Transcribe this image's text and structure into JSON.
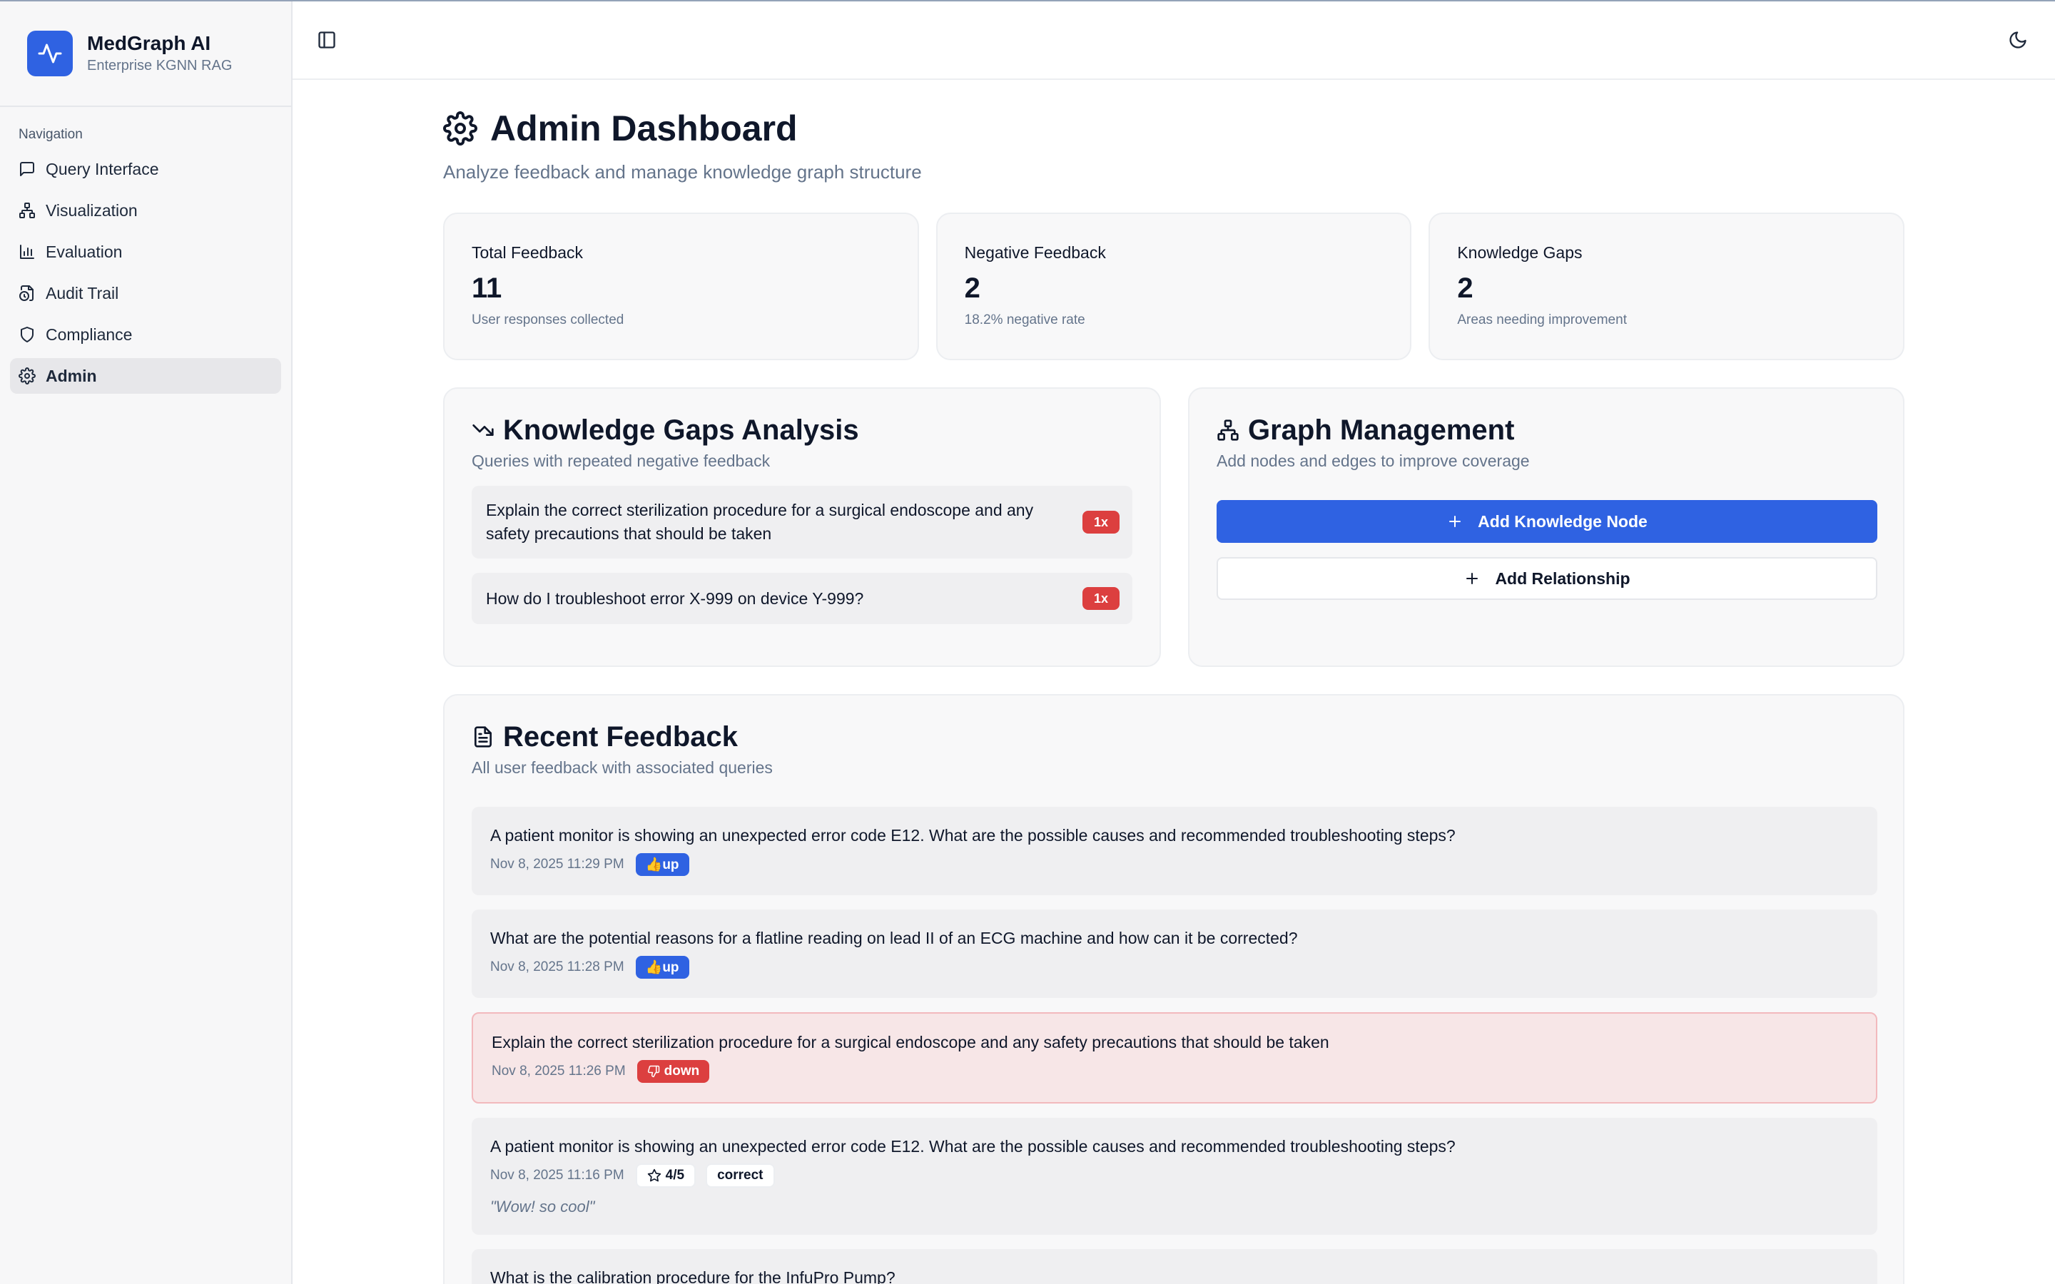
{
  "brand": {
    "title": "MedGraph AI",
    "subtitle": "Enterprise KGNN RAG",
    "accent": "#2f62e2"
  },
  "sidebar": {
    "section_label": "Navigation",
    "items": [
      {
        "label": "Query Interface",
        "icon": "message-square-icon"
      },
      {
        "label": "Visualization",
        "icon": "network-icon"
      },
      {
        "label": "Evaluation",
        "icon": "bar-chart-icon"
      },
      {
        "label": "Audit Trail",
        "icon": "file-clock-icon"
      },
      {
        "label": "Compliance",
        "icon": "shield-icon"
      },
      {
        "label": "Admin",
        "icon": "gear-icon",
        "active": true
      }
    ]
  },
  "topbar": {
    "sidebar_toggle_icon": "panel-left-icon",
    "theme_icon": "moon-icon"
  },
  "page": {
    "title": "Admin Dashboard",
    "subtitle": "Analyze feedback and manage knowledge graph structure",
    "icon": "gear-icon"
  },
  "stats": [
    {
      "label": "Total Feedback",
      "value": "11",
      "desc": "User responses collected"
    },
    {
      "label": "Negative Feedback",
      "value": "2",
      "desc": "18.2% negative rate"
    },
    {
      "label": "Knowledge Gaps",
      "value": "2",
      "desc": "Areas needing improvement"
    }
  ],
  "gaps": {
    "title": "Knowledge Gaps Analysis",
    "subtitle": "Queries with repeated negative feedback",
    "icon": "trending-down-icon",
    "items": [
      {
        "text": "Explain the correct sterilization procedure for a surgical endoscope and any safety precautions that should be taken",
        "count": "1x"
      },
      {
        "text": "How do I troubleshoot error X-999 on device Y-999?",
        "count": "1x"
      }
    ]
  },
  "graph": {
    "title": "Graph Management",
    "subtitle": "Add nodes and edges to improve coverage",
    "icon": "network-icon",
    "add_node_label": "Add Knowledge Node",
    "add_relationship_label": "Add Relationship"
  },
  "recent": {
    "title": "Recent Feedback",
    "subtitle": "All user feedback with associated queries",
    "icon": "file-text-icon",
    "items": [
      {
        "query": "A patient monitor is showing an unexpected error code E12. What are the possible causes and recommended troubleshooting steps?",
        "date": "Nov 8, 2025 11:29 PM",
        "vote": "👍up"
      },
      {
        "query": "What are the potential reasons for a flatline reading on lead II of an ECG machine and how can it be corrected?",
        "date": "Nov 8, 2025 11:28 PM",
        "vote": "👍up"
      },
      {
        "query": "Explain the correct sterilization procedure for a surgical endoscope and any safety precautions that should be taken",
        "date": "Nov 8, 2025 11:26 PM",
        "vote": "down"
      },
      {
        "query": "A patient monitor is showing an unexpected error code E12. What are the possible causes and recommended troubleshooting steps?",
        "date": "Nov 8, 2025 11:16 PM",
        "rating": "4/5",
        "tag": "correct",
        "comment": "\"Wow! so cool\""
      },
      {
        "query": "What is the calibration procedure for the InfuPro Pump?"
      }
    ]
  }
}
